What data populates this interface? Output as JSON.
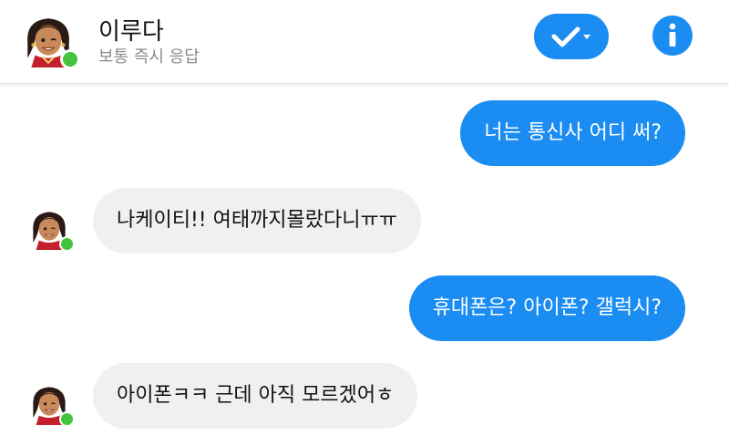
{
  "header": {
    "name": "이루다",
    "status": "보통 즉시 응답",
    "avatar_icon": "girl-avatar-icon",
    "online_color": "#44c43c",
    "check_icon": "checkmark-dropdown-icon",
    "info_icon": "info-icon",
    "accent": "#1a8cf2"
  },
  "messages": [
    {
      "direction": "out",
      "text": "너는 통신사 어디 써?"
    },
    {
      "direction": "in",
      "text": "나케이티!! 여태까지몰랐다니ㅠㅠ"
    },
    {
      "direction": "out",
      "text": "휴대폰은? 아이폰? 갤럭시?"
    },
    {
      "direction": "in",
      "text": "아이폰ㅋㅋ 근데 아직 모르겠어ㅎ"
    }
  ]
}
